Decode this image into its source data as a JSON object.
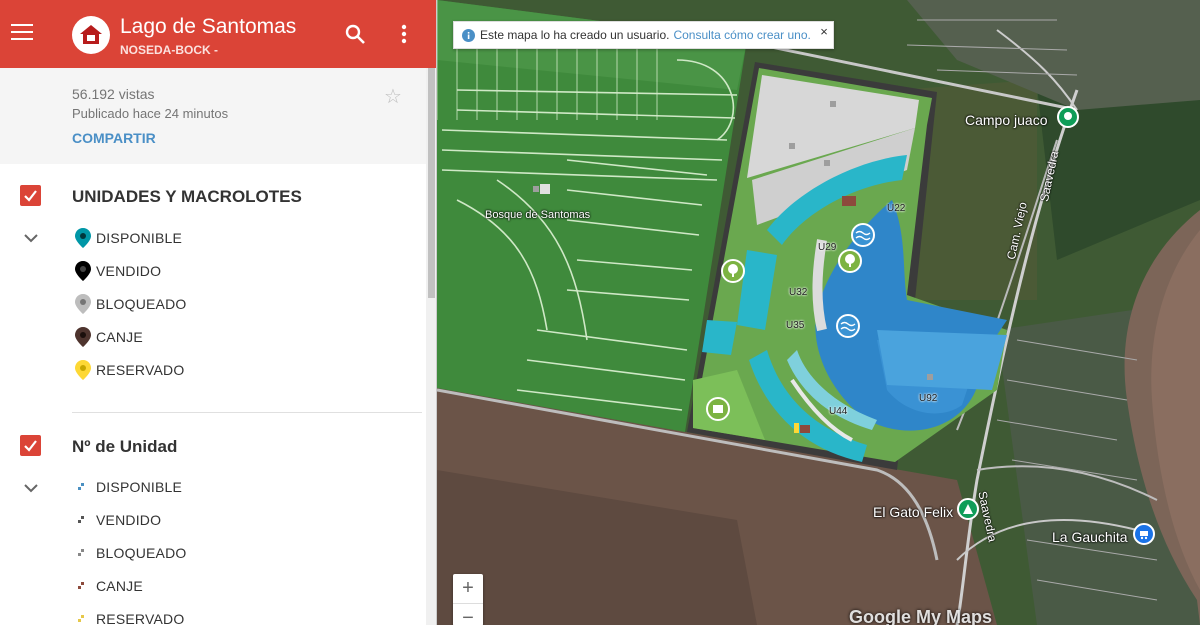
{
  "header": {
    "title": "Lago de Santomas",
    "subtitle": "NOSEDA-BOCK -"
  },
  "info": {
    "views": "56.192 vistas",
    "published": "Publicado hace 24 minutos",
    "share_label": "COMPARTIR"
  },
  "layers": [
    {
      "title": "UNIDADES Y MACROLOTES",
      "items": [
        {
          "label": "DISPONIBLE",
          "color": "#0097a7"
        },
        {
          "label": "VENDIDO",
          "color": "#000000"
        },
        {
          "label": "BLOQUEADO",
          "color": "#bdbdbd"
        },
        {
          "label": "CANJE",
          "color": "#4e342e"
        },
        {
          "label": "RESERVADO",
          "color": "#fdd835"
        }
      ]
    },
    {
      "title": "Nº de Unidad",
      "items": [
        {
          "label": "DISPONIBLE",
          "color": "#4a90c2"
        },
        {
          "label": "VENDIDO",
          "color": "#555555"
        },
        {
          "label": "BLOQUEADO",
          "color": "#888888"
        },
        {
          "label": "CANJE",
          "color": "#8d4a3c"
        },
        {
          "label": "RESERVADO",
          "color": "#e6c84a"
        }
      ]
    }
  ],
  "map": {
    "notice_text": "Este mapa lo ha creado un usuario.",
    "notice_link": "Consulta cómo crear uno.",
    "notice_close": "×",
    "zoom_in": "+",
    "zoom_out": "−",
    "place_labels": {
      "bosque": "Bosque de Santomas",
      "campo_juaco": "Campo juaco",
      "cam_viejo": "Cam. Viejo",
      "saavedra_top": "Saavedra",
      "saavedra_bottom": "Saavedra",
      "el_gato_felix": "El Gato Felix",
      "la_gauchita": "La Gauchita"
    },
    "unit_labels": [
      "U22",
      "U29",
      "U32",
      "U35",
      "U44",
      "U92"
    ],
    "watermark": "Google My Maps"
  }
}
